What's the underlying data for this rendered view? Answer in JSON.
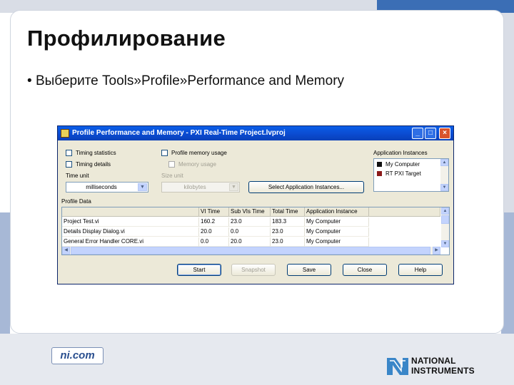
{
  "slide": {
    "title": "Профилирование",
    "bullet_prefix": "Выберите ",
    "bullet_path": "Tools»Profile»Performance and Memory",
    "footer_link": "ni.com",
    "logo_line1": "NATIONAL",
    "logo_line2": "INSTRUMENTS"
  },
  "window": {
    "title": "Profile Performance and Memory - PXI Real-Time Project.lvproj",
    "controls": {
      "minimize": "_",
      "maximize": "□",
      "close": "×"
    },
    "options": {
      "timing_statistics": "Timing statistics",
      "timing_details": "Timing details",
      "profile_memory": "Profile memory usage",
      "memory_usage": "Memory usage",
      "timing_statistics_checked": false,
      "timing_details_checked": false,
      "profile_memory_checked": false,
      "memory_usage_checked": false
    },
    "time_unit": {
      "label": "Time unit",
      "value": "milliseconds"
    },
    "size_unit": {
      "label": "Size unit",
      "value": "kilobytes"
    },
    "select_instances_button": "Select Application Instances...",
    "app_instances": {
      "label": "Application Instances",
      "items": [
        {
          "name": "My Computer",
          "color": "#111111"
        },
        {
          "name": "RT PXI Target",
          "color": "#8b1a1a"
        }
      ]
    },
    "profile_data": {
      "label": "Profile Data",
      "columns": [
        "",
        "VI Time",
        "Sub VIs Time",
        "Total Time",
        "Application Instance"
      ],
      "rows": [
        [
          "Project Test.vi",
          "160.2",
          "23.0",
          "183.3",
          "My Computer"
        ],
        [
          "Details Display Dialog.vi",
          "20.0",
          "0.0",
          "23.0",
          "My Computer"
        ],
        [
          "General Error Handler CORE.vi",
          "0.0",
          "20.0",
          "23.0",
          "My Computer"
        ]
      ]
    },
    "buttons": {
      "start": "Start",
      "snapshot": "Snapshot",
      "save": "Save",
      "close": "Close",
      "help": "Help"
    }
  }
}
